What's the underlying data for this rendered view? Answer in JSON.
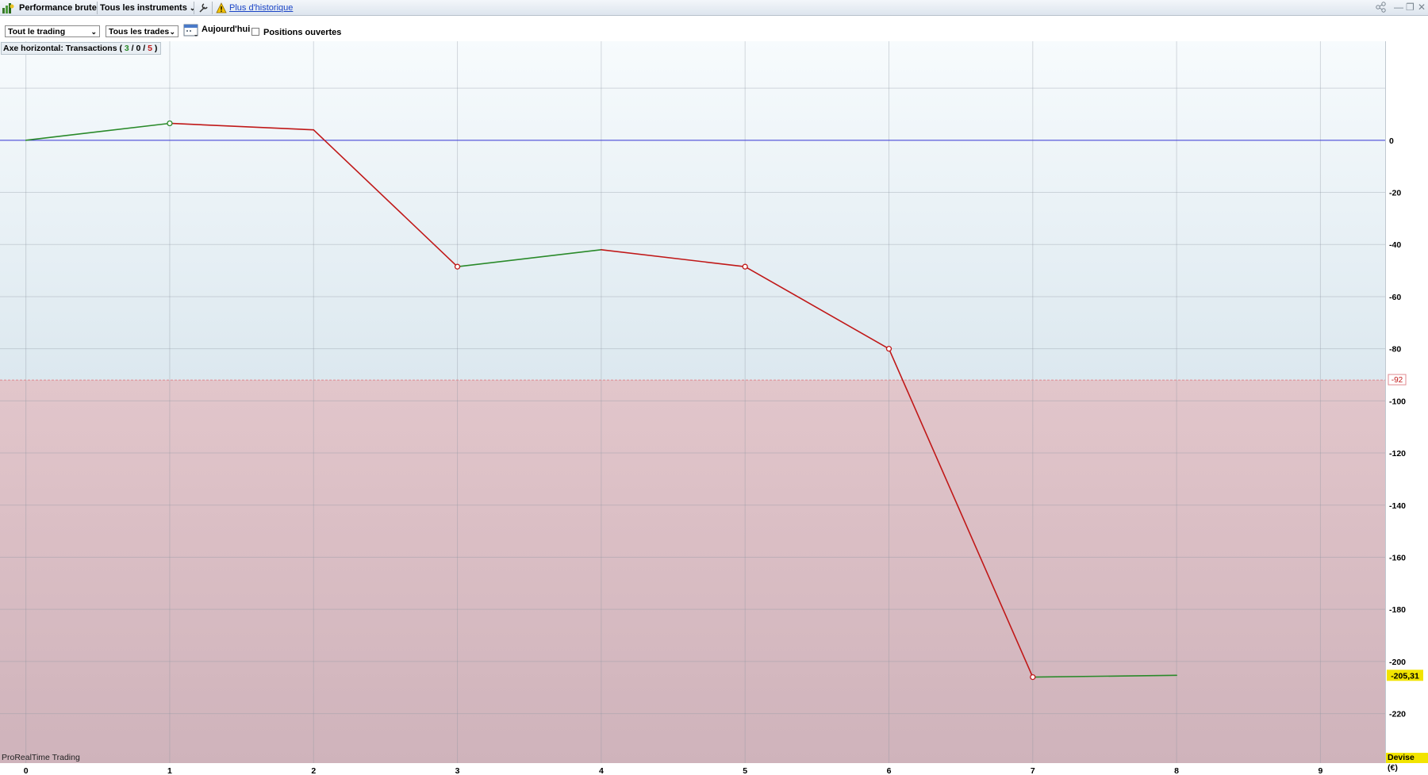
{
  "titlebar": {
    "view_label": "Performance brute",
    "instruments_label": "Tous les instruments",
    "history_link": "Plus d'historique",
    "icons": [
      "performance-chart-icon",
      "chevron-down-icon",
      "wrench-icon",
      "warning-icon",
      "share-icon",
      "minimize-icon",
      "restore-icon",
      "close-icon"
    ]
  },
  "toolbar": {
    "trading_select": "Tout le trading",
    "trades_select": "Tous les trades",
    "date_label": "Aujourd'hui",
    "open_positions_label": "Positions ouvertes",
    "open_positions_checked": false
  },
  "chart_overlay": {
    "axis_prefix": "Axe horizontal: Transactions ( ",
    "wins": "3",
    "slash1": " / ",
    "neutral": "0",
    "slash2": " / ",
    "losses": "5",
    "suffix": " )",
    "watermark": "ProRealTime Trading",
    "currency_label": "Devise (€)"
  },
  "colors": {
    "gain": "#2a8a2a",
    "loss": "#c01818",
    "zero_line": "#3a3ad8",
    "drawdown_line": "#e08a90",
    "last_value_bg": "#f2e400"
  },
  "chart_data": {
    "type": "line",
    "x": [
      0,
      1,
      2,
      3,
      4,
      5,
      6,
      7,
      8
    ],
    "y": [
      0,
      6.5,
      4,
      -48.5,
      -42,
      -48.5,
      -80,
      -206,
      -205.31
    ],
    "xlim": [
      -0.18,
      9.45
    ],
    "ylim": [
      -239,
      38
    ],
    "x_ticks": [
      0,
      1,
      2,
      3,
      4,
      5,
      6,
      7,
      8,
      9
    ],
    "y_ticks": [
      0,
      -20,
      -40,
      -60,
      -80,
      -100,
      -120,
      -140,
      -160,
      -180,
      -200,
      -220
    ],
    "grid": true,
    "reference_level": -92,
    "reference_label": "-92",
    "last_value": -205.31,
    "last_value_label": "-205,31",
    "trade_markers": [
      1,
      3,
      5,
      6,
      7
    ]
  }
}
